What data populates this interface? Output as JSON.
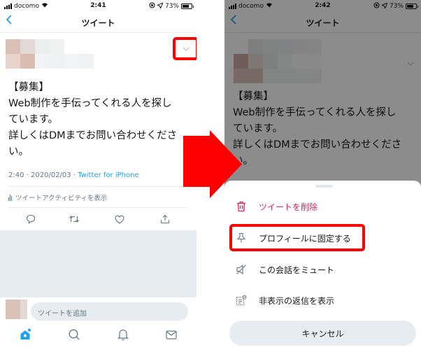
{
  "left": {
    "status": {
      "carrier": "docomo",
      "time": "2:41",
      "battery": "73%"
    },
    "nav": {
      "back_icon": "chevron-left",
      "title": "ツイート"
    },
    "tweet": {
      "caret_icon": "chevron-down",
      "text": "【募集】\nWeb制作を手伝ってくれる人を探し\nています。\n詳しくはDMまでお問い合わせくださ\nい。",
      "time": "2:40",
      "date": "2020/02/03",
      "separator": " · ",
      "source": "Twitter for iPhone",
      "activity_label": "ツイートアクティビティを表示"
    },
    "actions": [
      "reply",
      "retweet",
      "like",
      "share"
    ],
    "reply_placeholder": "ツイートを追加",
    "tabs": [
      "home",
      "search",
      "notifications",
      "messages"
    ]
  },
  "right": {
    "status": {
      "carrier": "docomo",
      "time": "2:42",
      "battery": "73%"
    },
    "nav": {
      "back_icon": "chevron-left",
      "title": "ツイート"
    },
    "tweet": {
      "text": "【募集】\nWeb制作を手伝ってくれる人を探し\nています。\n詳しくはDMまでお問い合わせくださ\nい。"
    },
    "sheet": {
      "items": [
        {
          "label": "ツイートを削除",
          "icon": "trash",
          "danger": true
        },
        {
          "label": "プロフィールに固定する",
          "icon": "pin",
          "highlighted": true
        },
        {
          "label": "この会話をミュート",
          "icon": "mute"
        },
        {
          "label": "非表示の返信を表示",
          "icon": "hidden-replies"
        }
      ],
      "cancel_label": "キャンセル"
    }
  },
  "colors": {
    "accent": "#1da1f2",
    "danger": "#e0245e",
    "highlight": "#ff0000",
    "secondary_text": "#657786",
    "divider": "#e6ecf0"
  }
}
